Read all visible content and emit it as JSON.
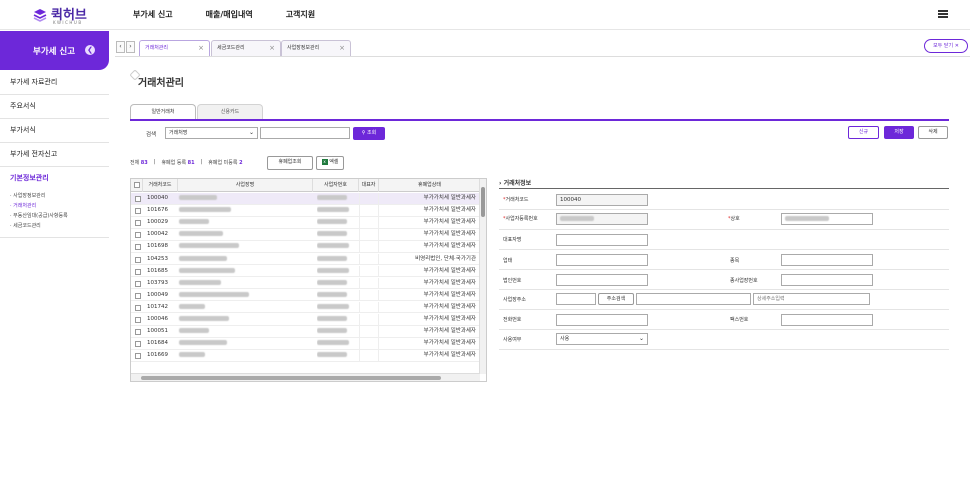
{
  "brand": {
    "name": "퀵허브",
    "sub": "KWICHUB"
  },
  "topnav": [
    "부가세 신고",
    "매출/매입내역",
    "고객지원"
  ],
  "side_title": "부가세 신고",
  "sidebar": {
    "items": [
      "부가세 자료관리",
      "주요서식",
      "부가서식",
      "부가세 전자신고"
    ],
    "active": "기본정보관리",
    "subs": [
      "· 사업장정보관리",
      "· 거래처관리",
      "· 부동산임대(공급)사항등록",
      "· 세금코드관리"
    ]
  },
  "tabs": [
    {
      "label": "거래처관리"
    },
    {
      "label": "세금코드관리"
    },
    {
      "label": "사업장정보관리"
    }
  ],
  "close_all": "모두 닫기 ✕",
  "page_title": "거래처관리",
  "subtabs": [
    "일반거래처",
    "신용카드"
  ],
  "search": {
    "label": "검색",
    "select": "거래처명",
    "button": "조회"
  },
  "actions": {
    "new": "신규",
    "save": "저장",
    "delete": "삭제"
  },
  "counts": {
    "total_label": "전체",
    "total": "83",
    "closed_label": "휴폐업 등록",
    "closed": "81",
    "unregistered_label": "휴폐업 미등록",
    "unregistered": "2"
  },
  "btn_closed_search": "휴폐업조회",
  "btn_excel": "엑셀",
  "grid": {
    "columns": [
      "거래처코드",
      "사업장명",
      "사업자번호",
      "대표자",
      "휴폐업상태"
    ],
    "rows": [
      {
        "code": "100040",
        "status": "부가가치세 일반과세자"
      },
      {
        "code": "101676",
        "status": "부가가치세 일반과세자"
      },
      {
        "code": "100029",
        "status": "부가가치세 일반과세자"
      },
      {
        "code": "100042",
        "status": "부가가치세 일반과세자"
      },
      {
        "code": "101698",
        "status": "부가가치세 일반과세자"
      },
      {
        "code": "104253",
        "status": "비영리법인, 단체·국가기관"
      },
      {
        "code": "101685",
        "status": "부가가치세 일반과세자"
      },
      {
        "code": "103793",
        "status": "부가가치세 일반과세자"
      },
      {
        "code": "100049",
        "status": "부가가치세 일반과세자"
      },
      {
        "code": "101742",
        "status": "부가가치세 일반과세자"
      },
      {
        "code": "100046",
        "status": "부가가치세 일반과세자"
      },
      {
        "code": "100051",
        "status": "부가가치세 일반과세자"
      },
      {
        "code": "101684",
        "status": "부가가치세 일반과세자"
      },
      {
        "code": "101669",
        "status": "부가가치세 일반과세자"
      }
    ]
  },
  "detail": {
    "title": "거래처정보",
    "code_label": "거래처코드",
    "code_value": "100040",
    "bizno_label": "사업자등록번호",
    "name_label": "상호",
    "ceo_label": "대표자명",
    "biztype_label": "업태",
    "item_label": "종목",
    "corpno_label": "법인번호",
    "mainbiz_label": "종사업장번호",
    "address_label": "사업장주소",
    "address_btn": "주소검색",
    "address_placeholder": "상세주소입력",
    "phone_label": "전화번호",
    "fax_label": "팩스번호",
    "use_label": "사용여부",
    "use_value": "사용"
  }
}
